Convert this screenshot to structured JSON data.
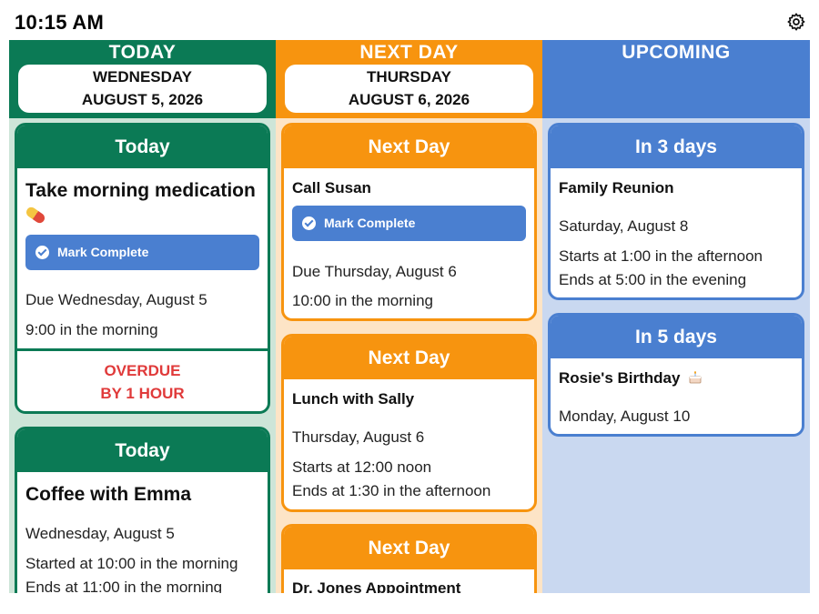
{
  "status_bar": {
    "time": "10:15 AM"
  },
  "columns": {
    "today": {
      "title": "TODAY",
      "day_of_week": "WEDNESDAY",
      "date": "AUGUST 5, 2026",
      "cards": [
        {
          "header": "Today",
          "title_line1": "Take morning medication",
          "icon": "pill-icon",
          "button": "Mark Complete",
          "due_line": "Due Wednesday, August 5",
          "time_line": "9:00 in the morning",
          "status_line1": "OVERDUE",
          "status_line2": "BY 1 HOUR"
        },
        {
          "header": "Today",
          "title": "Coffee with Emma",
          "date_line": "Wednesday, August 5",
          "start_line": "Started at 10:00 in the morning",
          "end_line": "Ends at 11:00 in the morning"
        }
      ]
    },
    "next_day": {
      "title": "NEXT DAY",
      "day_of_week": "THURSDAY",
      "date": "AUGUST 6, 2026",
      "cards": [
        {
          "header": "Next Day",
          "title": "Call Susan",
          "button": "Mark Complete",
          "due_line": "Due Thursday, August 6",
          "time_line": "10:00 in the morning"
        },
        {
          "header": "Next Day",
          "title": "Lunch with Sally",
          "date_line": "Thursday, August 6",
          "start_line": "Starts at 12:00 noon",
          "end_line": "Ends at 1:30 in the afternoon"
        },
        {
          "header": "Next Day",
          "title": "Dr. Jones Appointment"
        }
      ]
    },
    "upcoming": {
      "title": "UPCOMING",
      "cards": [
        {
          "header": "In 3 days",
          "title": "Family Reunion",
          "date_line": "Saturday, August 8",
          "start_line": "Starts at 1:00 in the afternoon",
          "end_line": "Ends at 5:00 in the evening"
        },
        {
          "header": "In 5 days",
          "title": "Rosie's Birthday",
          "icon": "cake-icon",
          "date_line": "Monday, August 10"
        }
      ]
    }
  },
  "colors": {
    "today": "#0b7a55",
    "next_day": "#f7940f",
    "upcoming": "#4a7fd0",
    "overdue": "#e03a3a"
  }
}
